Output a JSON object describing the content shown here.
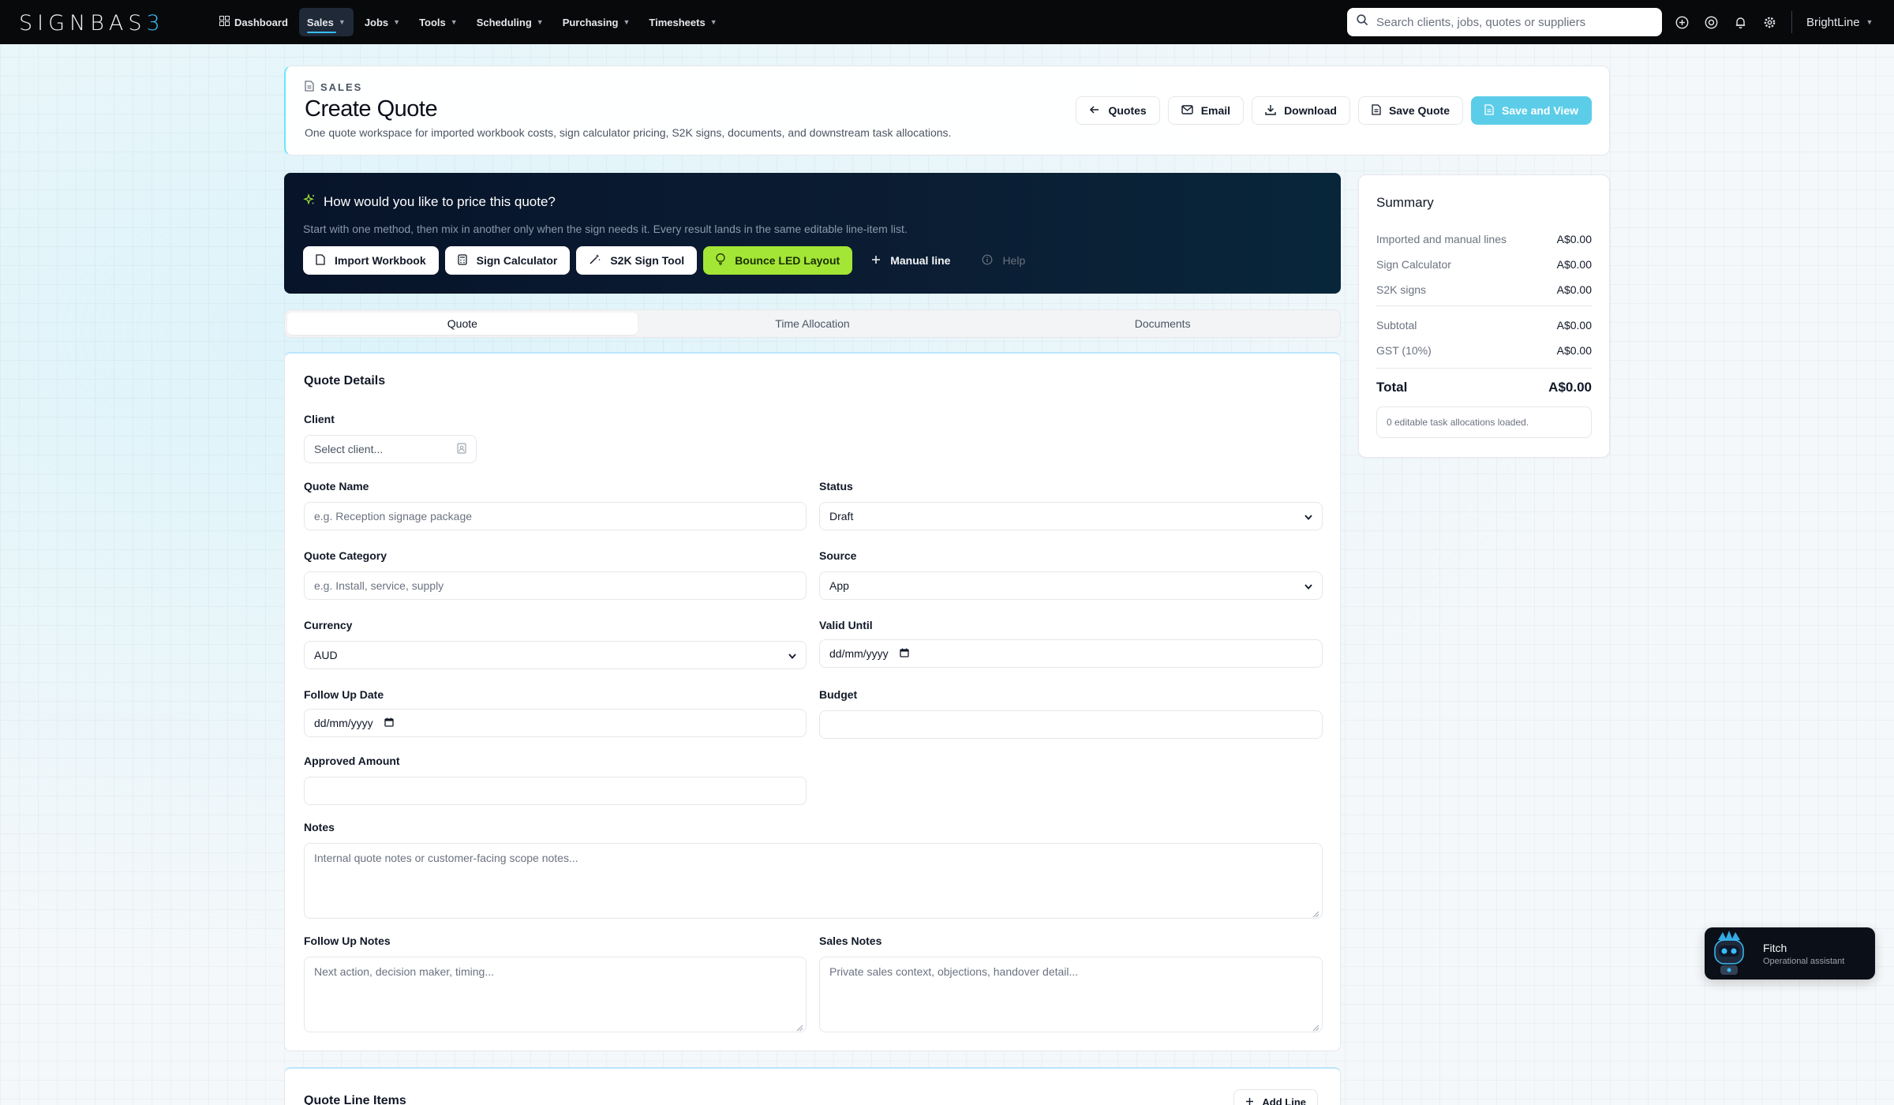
{
  "brand": {
    "logo_main": "SIGNBAS",
    "logo_accent": "3"
  },
  "nav": {
    "items": [
      {
        "label": "Dashboard",
        "active": false,
        "has_menu": false
      },
      {
        "label": "Sales",
        "active": true,
        "has_menu": true
      },
      {
        "label": "Jobs",
        "active": false,
        "has_menu": true
      },
      {
        "label": "Tools",
        "active": false,
        "has_menu": true
      },
      {
        "label": "Scheduling",
        "active": false,
        "has_menu": true
      },
      {
        "label": "Purchasing",
        "active": false,
        "has_menu": true
      },
      {
        "label": "Timesheets",
        "active": false,
        "has_menu": true
      }
    ],
    "search_placeholder": "Search clients, jobs, quotes or suppliers",
    "org_name": "BrightLine"
  },
  "header": {
    "eyebrow": "SALES",
    "title": "Create Quote",
    "subtitle": "One quote workspace for imported workbook costs, sign calculator pricing, S2K signs, documents, and downstream task allocations.",
    "actions": {
      "quotes": "Quotes",
      "email": "Email",
      "download": "Download",
      "save": "Save Quote",
      "save_view": "Save and View"
    }
  },
  "pricing": {
    "title": "How would you like to price this quote?",
    "subtitle": "Start with one method, then mix in another only when the sign needs it. Every result lands in the same editable line-item list.",
    "import_workbook": "Import Workbook",
    "sign_calculator": "Sign Calculator",
    "s2k_tool": "S2K Sign Tool",
    "bounce_led": "Bounce LED Layout",
    "manual_line": "Manual line",
    "help": "Help"
  },
  "tabs": {
    "quote": "Quote",
    "time_allocation": "Time Allocation",
    "documents": "Documents"
  },
  "form": {
    "section_title": "Quote Details",
    "client": {
      "label": "Client",
      "placeholder": "Select client..."
    },
    "quote_name": {
      "label": "Quote Name",
      "placeholder": "e.g. Reception signage package"
    },
    "status": {
      "label": "Status",
      "value": "Draft"
    },
    "quote_category": {
      "label": "Quote Category",
      "placeholder": "e.g. Install, service, supply"
    },
    "source": {
      "label": "Source",
      "value": "App"
    },
    "currency": {
      "label": "Currency",
      "value": "AUD"
    },
    "valid_until": {
      "label": "Valid Until",
      "value": "dd/mm/yyyy"
    },
    "follow_up_date": {
      "label": "Follow Up Date",
      "value": "dd/mm/yyyy"
    },
    "budget": {
      "label": "Budget"
    },
    "approved_amount": {
      "label": "Approved Amount"
    },
    "notes": {
      "label": "Notes",
      "placeholder": "Internal quote notes or customer-facing scope notes..."
    },
    "follow_up_notes": {
      "label": "Follow Up Notes",
      "placeholder": "Next action, decision maker, timing..."
    },
    "sales_notes": {
      "label": "Sales Notes",
      "placeholder": "Private sales context, objections, handover detail..."
    }
  },
  "line_items": {
    "title": "Quote Line Items",
    "add_line": "Add Line"
  },
  "summary": {
    "title": "Summary",
    "rows": [
      {
        "label": "Imported and manual lines",
        "amount": "A$0.00"
      },
      {
        "label": "Sign Calculator",
        "amount": "A$0.00"
      },
      {
        "label": "S2K signs",
        "amount": "A$0.00"
      }
    ],
    "subtotal": {
      "label": "Subtotal",
      "amount": "A$0.00"
    },
    "gst": {
      "label": "GST (10%)",
      "amount": "A$0.00"
    },
    "total": {
      "label": "Total",
      "amount": "A$0.00"
    },
    "note": "0 editable task allocations loaded."
  },
  "assistant": {
    "name": "Fitch",
    "role": "Operational assistant"
  },
  "colors": {
    "accent": "#38bdf8",
    "primary_button": "#5ccde9",
    "led_button": "#a3e635",
    "nav_bg": "#08090b"
  }
}
